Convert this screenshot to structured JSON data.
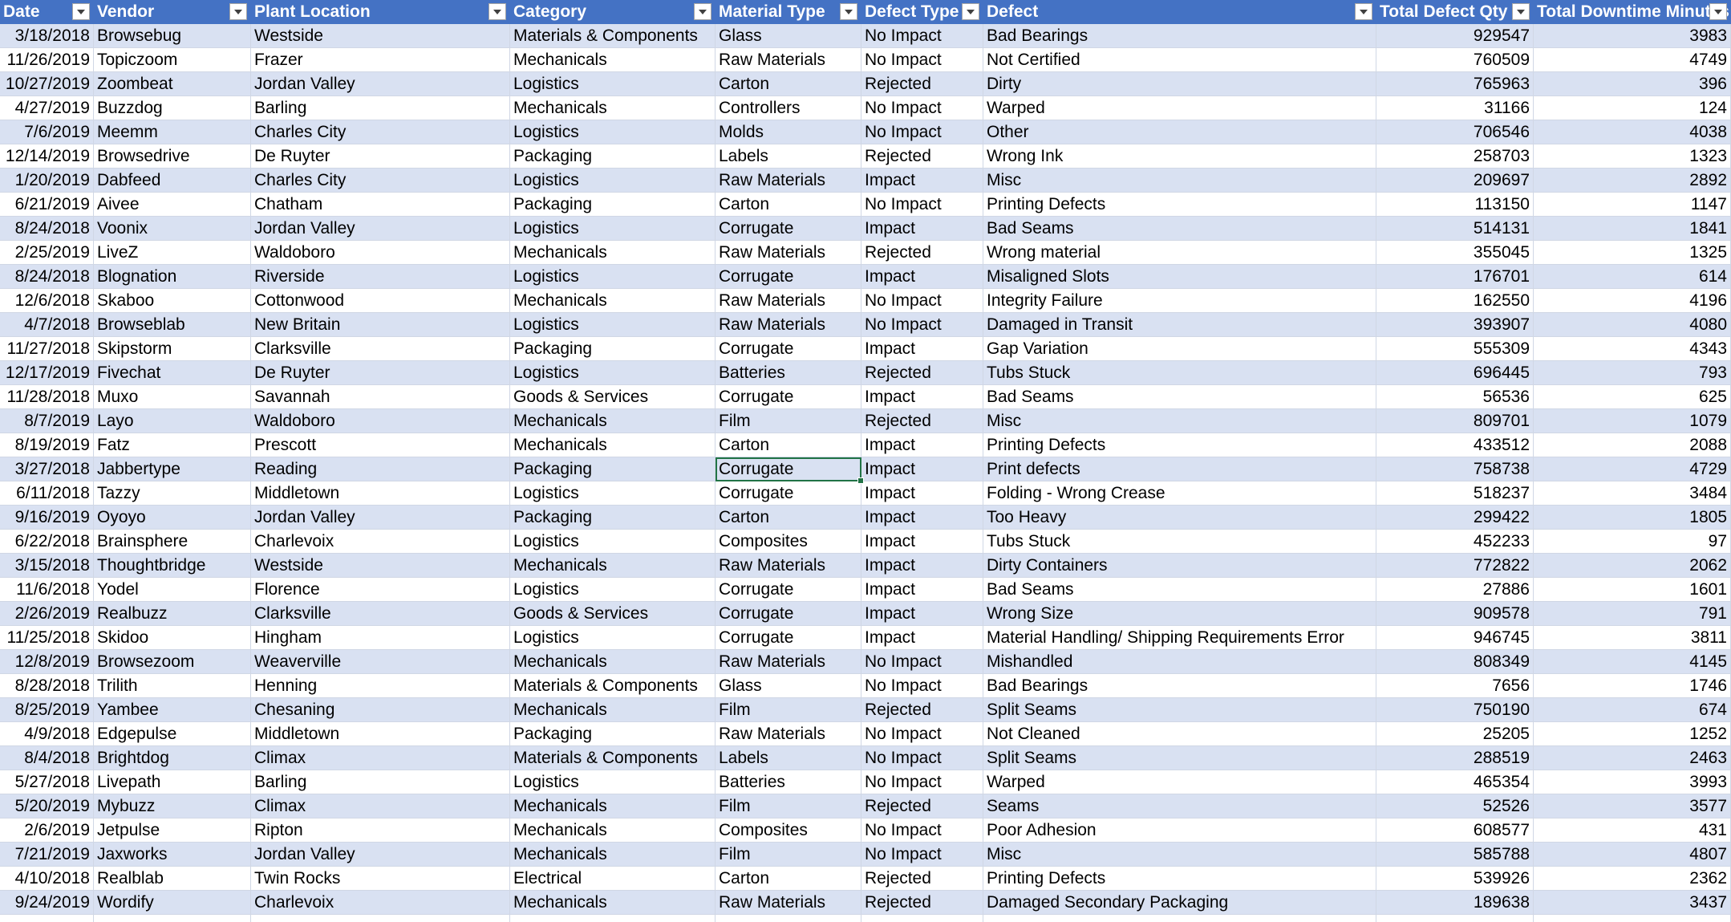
{
  "sheet": {
    "headers": [
      "Date",
      "Vendor",
      "Plant Location",
      "Category",
      "Material Type",
      "Defect Type",
      "Defect",
      "Total Defect Qty",
      "Total Downtime Minutes"
    ],
    "rows": [
      [
        "3/18/2018",
        "Browsebug",
        "Westside",
        "Materials & Components",
        "Glass",
        "No Impact",
        "Bad Bearings",
        "929547",
        "3983"
      ],
      [
        "11/26/2019",
        "Topiczoom",
        "Frazer",
        "Mechanicals",
        "Raw Materials",
        "No Impact",
        "Not Certified",
        "760509",
        "4749"
      ],
      [
        "10/27/2019",
        "Zoombeat",
        "Jordan Valley",
        "Logistics",
        "Carton",
        "Rejected",
        "Dirty",
        "765963",
        "396"
      ],
      [
        "4/27/2019",
        "Buzzdog",
        "Barling",
        "Mechanicals",
        "Controllers",
        "No Impact",
        "Warped",
        "31166",
        "124"
      ],
      [
        "7/6/2019",
        "Meemm",
        "Charles City",
        "Logistics",
        "Molds",
        "No Impact",
        "Other",
        "706546",
        "4038"
      ],
      [
        "12/14/2019",
        "Browsedrive",
        "De Ruyter",
        "Packaging",
        "Labels",
        "Rejected",
        "Wrong Ink",
        "258703",
        "1323"
      ],
      [
        "1/20/2019",
        "Dabfeed",
        "Charles City",
        "Logistics",
        "Raw Materials",
        "Impact",
        "Misc",
        "209697",
        "2892"
      ],
      [
        "6/21/2019",
        "Aivee",
        "Chatham",
        "Packaging",
        "Carton",
        "No Impact",
        "Printing Defects",
        "113150",
        "1147"
      ],
      [
        "8/24/2018",
        "Voonix",
        "Jordan Valley",
        "Logistics",
        "Corrugate",
        "Impact",
        "Bad Seams",
        "514131",
        "1841"
      ],
      [
        "2/25/2019",
        "LiveZ",
        "Waldoboro",
        "Mechanicals",
        "Raw Materials",
        "Rejected",
        "Wrong material",
        "355045",
        "1325"
      ],
      [
        "8/24/2018",
        "Blognation",
        "Riverside",
        "Logistics",
        "Corrugate",
        "Impact",
        "Misaligned Slots",
        "176701",
        "614"
      ],
      [
        "12/6/2018",
        "Skaboo",
        "Cottonwood",
        "Mechanicals",
        "Raw Materials",
        "No Impact",
        "Integrity Failure",
        "162550",
        "4196"
      ],
      [
        "4/7/2018",
        "Browseblab",
        "New Britain",
        "Logistics",
        "Raw Materials",
        "No Impact",
        "Damaged in Transit",
        "393907",
        "4080"
      ],
      [
        "11/27/2018",
        "Skipstorm",
        "Clarksville",
        "Packaging",
        "Corrugate",
        "Impact",
        "Gap Variation",
        "555309",
        "4343"
      ],
      [
        "12/17/2019",
        "Fivechat",
        "De Ruyter",
        "Logistics",
        "Batteries",
        "Rejected",
        "Tubs Stuck",
        "696445",
        "793"
      ],
      [
        "11/28/2018",
        "Muxo",
        "Savannah",
        "Goods & Services",
        "Corrugate",
        "Impact",
        "Bad Seams",
        "56536",
        "625"
      ],
      [
        "8/7/2019",
        "Layo",
        "Waldoboro",
        "Mechanicals",
        "Film",
        "Rejected",
        "Misc",
        "809701",
        "1079"
      ],
      [
        "8/19/2019",
        "Fatz",
        "Prescott",
        "Mechanicals",
        "Carton",
        "Impact",
        "Printing Defects",
        "433512",
        "2088"
      ],
      [
        "3/27/2018",
        "Jabbertype",
        "Reading",
        "Packaging",
        "Corrugate",
        "Impact",
        "Print defects",
        "758738",
        "4729"
      ],
      [
        "6/11/2018",
        "Tazzy",
        "Middletown",
        "Logistics",
        "Corrugate",
        "Impact",
        "Folding - Wrong Crease",
        "518237",
        "3484"
      ],
      [
        "9/16/2019",
        "Oyoyo",
        "Jordan Valley",
        "Packaging",
        "Carton",
        "Impact",
        "Too Heavy",
        "299422",
        "1805"
      ],
      [
        "6/22/2018",
        "Brainsphere",
        "Charlevoix",
        "Logistics",
        "Composites",
        "Impact",
        "Tubs Stuck",
        "452233",
        "97"
      ],
      [
        "3/15/2018",
        "Thoughtbridge",
        "Westside",
        "Mechanicals",
        "Raw Materials",
        "Impact",
        "Dirty Containers",
        "772822",
        "2062"
      ],
      [
        "11/6/2018",
        "Yodel",
        "Florence",
        "Logistics",
        "Corrugate",
        "Impact",
        "Bad Seams",
        "27886",
        "1601"
      ],
      [
        "2/26/2019",
        "Realbuzz",
        "Clarksville",
        "Goods & Services",
        "Corrugate",
        "Impact",
        "Wrong  Size",
        "909578",
        "791"
      ],
      [
        "11/25/2018",
        "Skidoo",
        "Hingham",
        "Logistics",
        "Corrugate",
        "Impact",
        "Material Handling/ Shipping Requirements Error",
        "946745",
        "3811"
      ],
      [
        "12/8/2019",
        "Browsezoom",
        "Weaverville",
        "Mechanicals",
        "Raw Materials",
        "No Impact",
        "Mishandled",
        "808349",
        "4145"
      ],
      [
        "8/28/2018",
        "Trilith",
        "Henning",
        "Materials & Components",
        "Glass",
        "No Impact",
        "Bad Bearings",
        "7656",
        "1746"
      ],
      [
        "8/25/2019",
        "Yambee",
        "Chesaning",
        "Mechanicals",
        "Film",
        "Rejected",
        "Split Seams",
        "750190",
        "674"
      ],
      [
        "4/9/2018",
        "Edgepulse",
        "Middletown",
        "Packaging",
        "Raw Materials",
        "No Impact",
        "Not Cleaned",
        "25205",
        "1252"
      ],
      [
        "8/4/2018",
        "Brightdog",
        "Climax",
        "Materials & Components",
        "Labels",
        "No Impact",
        "Split Seams",
        "288519",
        "2463"
      ],
      [
        "5/27/2018",
        "Livepath",
        "Barling",
        "Logistics",
        "Batteries",
        "No Impact",
        "Warped",
        "465354",
        "3993"
      ],
      [
        "5/20/2019",
        "Mybuzz",
        "Climax",
        "Mechanicals",
        "Film",
        "Rejected",
        "Seams",
        "52526",
        "3577"
      ],
      [
        "2/6/2019",
        "Jetpulse",
        "Ripton",
        "Mechanicals",
        "Composites",
        "No Impact",
        "Poor  Adhesion",
        "608577",
        "431"
      ],
      [
        "7/21/2019",
        "Jaxworks",
        "Jordan Valley",
        "Mechanicals",
        "Film",
        "No Impact",
        "Misc",
        "585788",
        "4807"
      ],
      [
        "4/10/2018",
        "Realblab",
        "Twin Rocks",
        "Electrical",
        "Carton",
        "Rejected",
        "Printing Defects",
        "539926",
        "2362"
      ],
      [
        "9/24/2019",
        "Wordify",
        "Charlevoix",
        "Mechanicals",
        "Raw Materials",
        "Rejected",
        "Damaged Secondary Packaging",
        "189638",
        "3437"
      ]
    ],
    "selected_cell": {
      "row": 18,
      "col": 4
    },
    "colors": {
      "header_bg": "#4472c4",
      "header_text": "#ffffff",
      "band_bg": "#d9e1f2",
      "selection": "#217346"
    }
  }
}
